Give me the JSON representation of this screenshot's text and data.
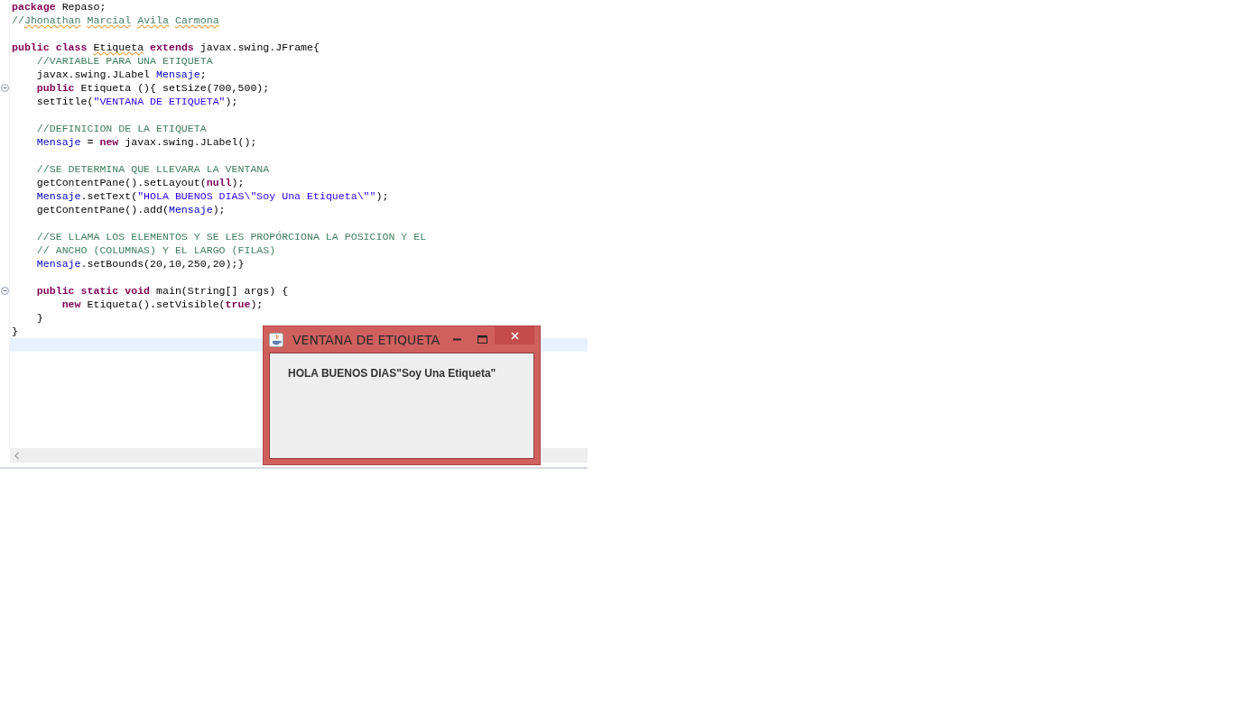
{
  "editor": {
    "lines": [
      {
        "fold": false,
        "current": false,
        "tokens": [
          {
            "kind": "keyword",
            "text": "package"
          },
          {
            "kind": "plain",
            "text": " Repaso;"
          }
        ]
      },
      {
        "fold": false,
        "current": false,
        "tokens": [
          {
            "kind": "comment",
            "text": "//"
          },
          {
            "kind": "typo-comment",
            "text": "Jhonathan "
          },
          {
            "kind": "typo-comment",
            "text": "Marcial "
          },
          {
            "kind": "typo-comment",
            "text": "Avila "
          },
          {
            "kind": "typo-comment",
            "text": "Carmona"
          }
        ]
      },
      {
        "fold": false,
        "current": false
      },
      {
        "fold": false,
        "current": false,
        "tokens": [
          {
            "kind": "keyword",
            "text": "public class "
          },
          {
            "kind": "typo",
            "text": "Etiqueta "
          },
          {
            "kind": "keyword",
            "text": "extends"
          },
          {
            "kind": "plain",
            "text": " javax.swing.JFrame{"
          }
        ]
      },
      {
        "fold": false,
        "current": false,
        "tokens": [
          {
            "kind": "comment",
            "text": "    //VARIABLE PARA UNA ETIQUETA"
          }
        ]
      },
      {
        "fold": false,
        "current": false,
        "tokens": [
          {
            "kind": "plain",
            "text": "    javax.swing.JLabel "
          },
          {
            "kind": "field",
            "text": "Mensaje"
          },
          {
            "kind": "plain",
            "text": ";"
          }
        ]
      },
      {
        "fold": true,
        "current": false,
        "tokens": [
          {
            "kind": "keyword",
            "text": "    public"
          },
          {
            "kind": "plain",
            "text": " Etiqueta (){ setSize(700,500);"
          }
        ]
      },
      {
        "fold": false,
        "current": false,
        "tokens": [
          {
            "kind": "plain",
            "text": "    setTitle("
          },
          {
            "kind": "string",
            "text": "\"VENTANA DE ETIQUETA\""
          },
          {
            "kind": "plain",
            "text": ");"
          }
        ]
      },
      {
        "fold": false,
        "current": false
      },
      {
        "fold": false,
        "current": false,
        "tokens": [
          {
            "kind": "comment",
            "text": "    //DEFINICION DE LA ETIQUETA"
          }
        ]
      },
      {
        "fold": false,
        "current": false,
        "tokens": [
          {
            "kind": "field",
            "text": "    Mensaje"
          },
          {
            "kind": "plain",
            "text": " = "
          },
          {
            "kind": "keyword",
            "text": "new"
          },
          {
            "kind": "plain",
            "text": " javax.swing.JLabel();"
          }
        ]
      },
      {
        "fold": false,
        "current": false
      },
      {
        "fold": false,
        "current": false,
        "tokens": [
          {
            "kind": "comment",
            "text": "    //SE DETERMINA QUE LLEVARA LA VENTANA"
          }
        ]
      },
      {
        "fold": false,
        "current": false,
        "tokens": [
          {
            "kind": "plain",
            "text": "    getContentPane().setLayout("
          },
          {
            "kind": "keyword",
            "text": "null"
          },
          {
            "kind": "plain",
            "text": ");"
          }
        ]
      },
      {
        "fold": false,
        "current": false,
        "tokens": [
          {
            "kind": "field",
            "text": "    Mensaje"
          },
          {
            "kind": "plain",
            "text": ".setText("
          },
          {
            "kind": "string",
            "text": "\"HOLA BUENOS DIAS\\\"Soy Una Etiqueta\\\"\""
          },
          {
            "kind": "plain",
            "text": ");"
          }
        ]
      },
      {
        "fold": false,
        "current": false,
        "tokens": [
          {
            "kind": "plain",
            "text": "    getContentPane().add("
          },
          {
            "kind": "field",
            "text": "Mensaje"
          },
          {
            "kind": "plain",
            "text": ");"
          }
        ]
      },
      {
        "fold": false,
        "current": false
      },
      {
        "fold": false,
        "current": false,
        "tokens": [
          {
            "kind": "comment",
            "text": "    //SE LLAMA LOS ELEMENTOS Y SE LES PROPÓRCIONA LA POSICION Y EL"
          }
        ]
      },
      {
        "fold": false,
        "current": false,
        "tokens": [
          {
            "kind": "comment",
            "text": "    // ANCHO (COLUMNAS) Y EL LARGO (FILAS)"
          }
        ]
      },
      {
        "fold": false,
        "current": false,
        "tokens": [
          {
            "kind": "field",
            "text": "    Mensaje"
          },
          {
            "kind": "plain",
            "text": ".setBounds(20,10,250,20);}"
          }
        ]
      },
      {
        "fold": false,
        "current": false
      },
      {
        "fold": true,
        "current": false,
        "tokens": [
          {
            "kind": "keyword",
            "text": "    public static void"
          },
          {
            "kind": "plain",
            "text": " main(String[] args) {"
          }
        ]
      },
      {
        "fold": false,
        "current": false,
        "tokens": [
          {
            "kind": "keyword",
            "text": "        new"
          },
          {
            "kind": "plain",
            "text": " Etiqueta().setVisible("
          },
          {
            "kind": "keyword",
            "text": "true"
          },
          {
            "kind": "plain",
            "text": ");"
          }
        ]
      },
      {
        "fold": false,
        "current": false,
        "tokens": [
          {
            "kind": "plain",
            "text": "    }"
          }
        ]
      },
      {
        "fold": false,
        "current": false,
        "tokens": [
          {
            "kind": "plain",
            "text": "}"
          }
        ]
      },
      {
        "fold": false,
        "current": true
      }
    ]
  },
  "app_window": {
    "title": "VENTANA DE ETIQUETA",
    "label": "HOLA BUENOS DIAS\"Soy Una Etiqueta\""
  }
}
